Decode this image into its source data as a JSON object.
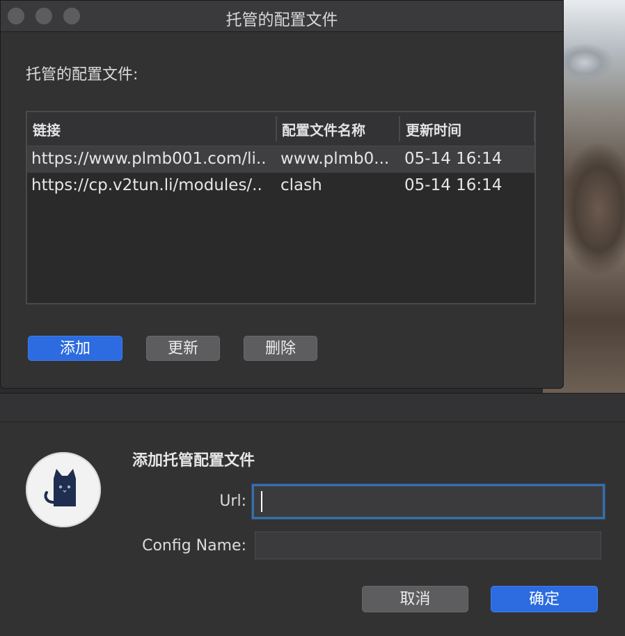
{
  "window": {
    "title": "托管的配置文件",
    "section_label": "托管的配置文件:",
    "table": {
      "headers": [
        "链接",
        "配置文件名称",
        "更新时间"
      ],
      "rows": [
        {
          "url": "https://www.plmb001.com/li..",
          "name": "www.plmb0...",
          "time": "05-14 16:14",
          "selected": true
        },
        {
          "url": "https://cp.v2tun.li/modules/..",
          "name": "clash",
          "time": "05-14 16:14",
          "selected": false
        }
      ]
    },
    "buttons": {
      "add": "添加",
      "update": "更新",
      "delete": "删除"
    }
  },
  "sheet": {
    "title": "添加托管配置文件",
    "url_label": "Url:",
    "url_value": "",
    "config_label": "Config Name:",
    "config_value": "",
    "cancel": "取消",
    "confirm": "确定"
  },
  "colors": {
    "accent": "#2c6be0",
    "focus_ring": "#3a6ea8"
  },
  "icons": {
    "app": "clash-cat-icon"
  }
}
